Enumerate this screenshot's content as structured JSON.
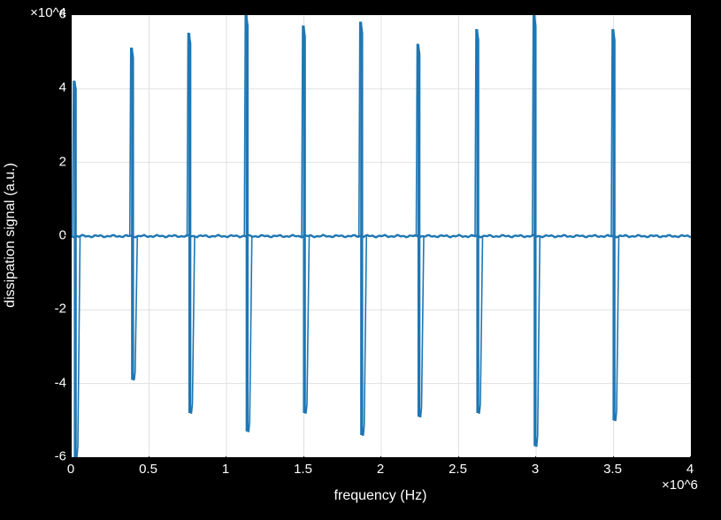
{
  "chart_data": {
    "type": "line",
    "title": "",
    "xlabel": "frequency (Hz)",
    "ylabel": "dissipation signal (a.u.)",
    "xlim": [
      0,
      4000000
    ],
    "ylim": [
      -60000,
      60000
    ],
    "xticks": [
      0,
      500000,
      1000000,
      1500000,
      2000000,
      2500000,
      3000000,
      3500000,
      4000000
    ],
    "xtick_labels": [
      "0",
      "0.5",
      "1",
      "1.5",
      "2",
      "2.5",
      "3",
      "3.5",
      "4"
    ],
    "xtick_suffix": "×10^6",
    "yticks": [
      -60000,
      -40000,
      -20000,
      0,
      20000,
      40000,
      60000
    ],
    "ytick_labels": [
      "-6",
      "-4",
      "-2",
      "0",
      "2",
      "4",
      "6"
    ],
    "ytick_suffix": "×10^4",
    "baseline": 0,
    "baseline_extent_x": [
      0,
      4000000
    ],
    "spikes": [
      {
        "x": 20000,
        "pos_peak": 42000,
        "neg_peak": -60000
      },
      {
        "x": 390000,
        "pos_peak": 51000,
        "neg_peak": -39000
      },
      {
        "x": 760000,
        "pos_peak": 55000,
        "neg_peak": -48000
      },
      {
        "x": 1130000,
        "pos_peak": 60000,
        "neg_peak": -53000
      },
      {
        "x": 1500000,
        "pos_peak": 57000,
        "neg_peak": -48000
      },
      {
        "x": 1870000,
        "pos_peak": 58000,
        "neg_peak": -54000
      },
      {
        "x": 2240000,
        "pos_peak": 52000,
        "neg_peak": -49000
      },
      {
        "x": 2620000,
        "pos_peak": 56000,
        "neg_peak": -48000
      },
      {
        "x": 2990000,
        "pos_peak": 60000,
        "neg_peak": -57000
      },
      {
        "x": 3500000,
        "pos_peak": 56000,
        "neg_peak": -50000
      }
    ],
    "series_color": "#1f77b4",
    "grid": true
  }
}
